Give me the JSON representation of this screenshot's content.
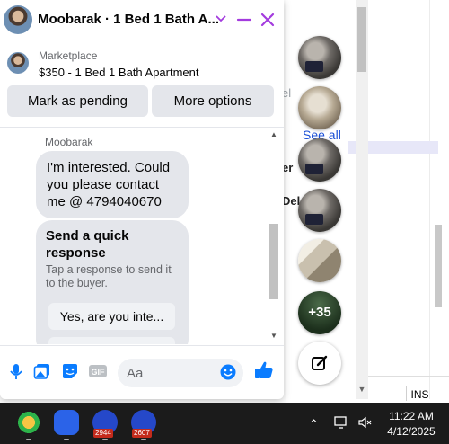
{
  "chat": {
    "title": "Moobarak · 1 Bed 1 Bath A...",
    "marketplace": {
      "source": "Marketplace",
      "listing": "$350 - 1 Bed 1 Bath Apartment",
      "mark_pending_label": "Mark as pending",
      "more_options_label": "More options"
    },
    "messages": {
      "sender": "Moobarak",
      "text": "I'm interested. Could you please contact me @ 4794040670",
      "quick_reply": {
        "title": "Send a quick response",
        "subtitle": "Tap a response to send it to the buyer.",
        "option_1": "Yes, are you inte..."
      }
    },
    "composer": {
      "placeholder": "Aa"
    }
  },
  "background": {
    "frag_el": "el",
    "see_all": "See all",
    "frag_er": "er",
    "frag_del": "Del",
    "status_ins": "INS"
  },
  "chat_heads": {
    "more_count": "+35"
  },
  "taskbar": {
    "badge_1": "2944",
    "badge_2": "2607",
    "time": "11:22 AM",
    "date": "4/12/2025"
  },
  "colors": {
    "messenger_accent": "#a33bde",
    "like_blue": "#0a7cff",
    "bubble_gray": "#e4e6eb"
  }
}
